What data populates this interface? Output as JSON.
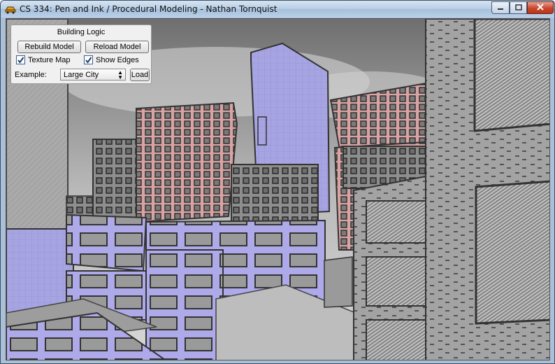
{
  "window": {
    "title": "CS 334: Pen and Ink / Procedural Modeling - Nathan Tornquist",
    "icons": {
      "app": "car-icon",
      "minimize": "minimize-icon",
      "maximize": "maximize-icon",
      "close": "close-icon"
    }
  },
  "panel": {
    "title": "Building Logic",
    "rebuild_label": "Rebuild Model",
    "reload_label": "Reload Model",
    "texture_label": "Texture Map",
    "texture_checked": true,
    "edges_label": "Show Edges",
    "edges_checked": true,
    "example_label": "Example:",
    "example_value": "Large City",
    "load_label": "Load"
  },
  "scene": {
    "description_colors": {
      "lavender": "#a9a6e6",
      "pink": "#d7a2a2",
      "grey": "#8a8a8a",
      "sky": "#bdbdbd"
    }
  }
}
